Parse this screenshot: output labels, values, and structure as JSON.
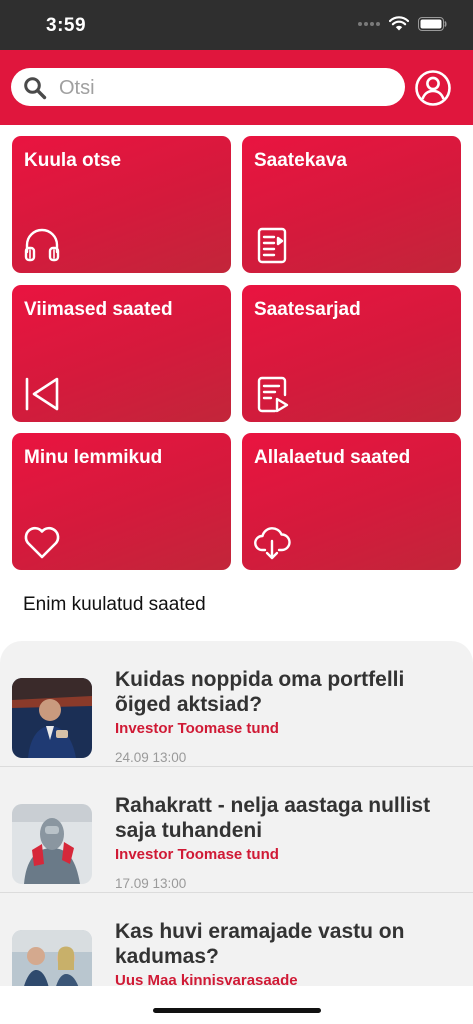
{
  "status_bar": {
    "time": "3:59"
  },
  "search": {
    "placeholder": "Otsi",
    "value": ""
  },
  "tiles": [
    {
      "label": "Kuula otse",
      "icon": "headphones-icon"
    },
    {
      "label": "Saatekava",
      "icon": "schedule-list-icon"
    },
    {
      "label": "Viimased saated",
      "icon": "skip-back-icon"
    },
    {
      "label": "Saatesarjad",
      "icon": "series-document-icon"
    },
    {
      "label": "Minu lemmikud",
      "icon": "heart-icon"
    },
    {
      "label": "Allalaetud saated",
      "icon": "cloud-download-icon"
    }
  ],
  "section": {
    "title": "Enim kuulatud saated"
  },
  "episodes": [
    {
      "title": "Kuidas noppida oma portfelli õiged aktsiad?",
      "show": "Investor Toomase tund",
      "date": "24.09 13:00"
    },
    {
      "title": "Rahakratt - nelja aastaga nullist saja tuhandeni",
      "show": "Investor Toomase tund",
      "date": "17.09 13:00"
    },
    {
      "title": "Kas huvi eramajade vastu on kadumas?",
      "show": "Uus Maa kinnisvarasaade",
      "date": ""
    }
  ],
  "colors": {
    "accent": "#e0163d",
    "status_bar": "#2f2f2f",
    "show_text": "#d01a35",
    "list_bg": "#f2f2f2"
  }
}
